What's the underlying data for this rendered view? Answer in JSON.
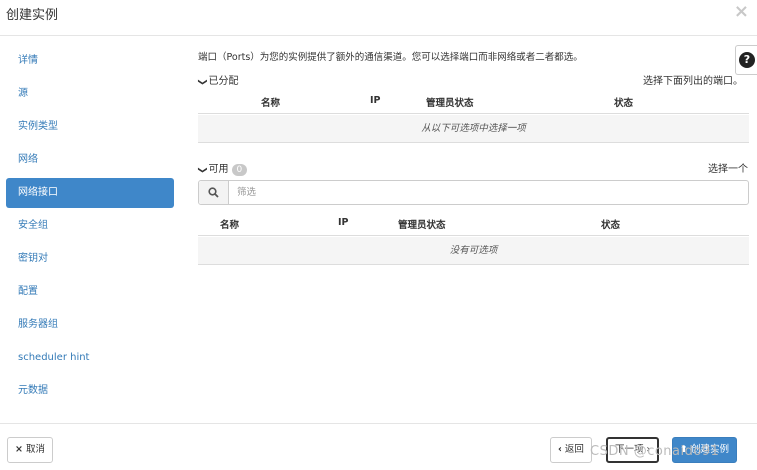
{
  "dialog": {
    "title": "创建实例"
  },
  "sidebar": {
    "items": [
      {
        "label": "详情"
      },
      {
        "label": "源"
      },
      {
        "label": "实例类型"
      },
      {
        "label": "网络"
      },
      {
        "label": "网络接口"
      },
      {
        "label": "安全组"
      },
      {
        "label": "密钥对"
      },
      {
        "label": "配置"
      },
      {
        "label": "服务器组"
      },
      {
        "label": "scheduler hint"
      },
      {
        "label": "元数据"
      }
    ],
    "active_index": 4
  },
  "main": {
    "intro": "端口（Ports）为您的实例提供了额外的通信渠道。您可以选择端口而非网络或者二者都选。",
    "allocated": {
      "title": "已分配",
      "hint": "选择下面列出的端口。",
      "columns": [
        "名称",
        "IP",
        "管理员状态",
        "状态"
      ],
      "empty_text": "从以下可选项中选择一项"
    },
    "available": {
      "title": "可用",
      "count": "0",
      "hint": "选择一个",
      "search_placeholder": "筛选",
      "columns": [
        "名称",
        "IP",
        "管理员状态",
        "状态"
      ],
      "empty_text": "没有可选项"
    }
  },
  "footer": {
    "cancel_label": "取消",
    "back_label": "返回",
    "next_label": "下一项",
    "create_label": "创建实例"
  },
  "watermark": "CSDN @conaido91",
  "colors": {
    "primary": "#3f87c9",
    "link": "#337ab7",
    "muted_badge": "#c8c8c8"
  }
}
